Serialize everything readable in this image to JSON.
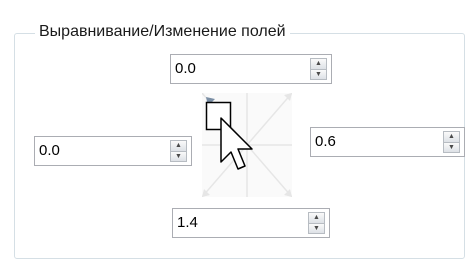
{
  "group": {
    "title": "Выравнивание/Изменение полей"
  },
  "margins": {
    "top": "0.0",
    "left": "0.0",
    "right": "0.6",
    "bottom": "1.4"
  },
  "icons": {
    "spin_up": "chevron-up-icon",
    "spin_down": "chevron-down-icon",
    "preview": "margin-preview-icon",
    "cursor": "mouse-pointer-icon"
  }
}
